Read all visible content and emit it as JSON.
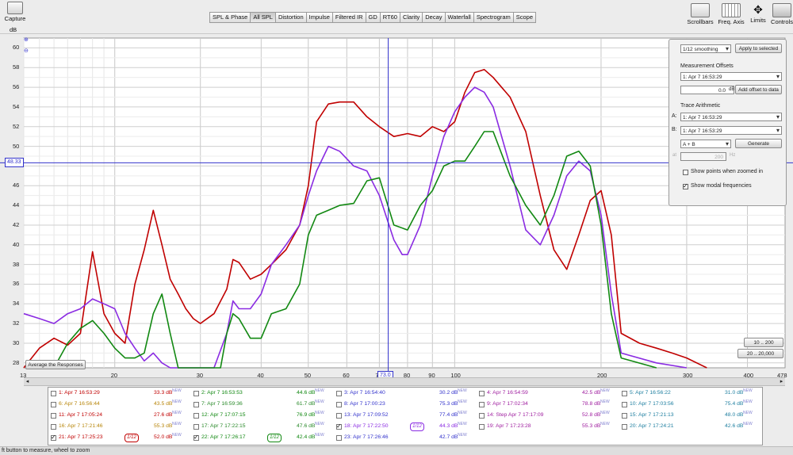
{
  "toolbar": {
    "capture": {
      "label": "Capture"
    },
    "db_label": "dB",
    "tabs": [
      "SPL & Phase",
      "All SPL",
      "Distortion",
      "Impulse",
      "Filtered IR",
      "GD",
      "RT60",
      "Clarity",
      "Decay",
      "Waterfall",
      "Spectrogram",
      "Scope"
    ],
    "active_tab": "All SPL",
    "right": [
      "Scrollbars",
      "Freq. Axis",
      "Limits",
      "Controls"
    ]
  },
  "plot": {
    "y_ticks": [
      "60",
      "58",
      "56",
      "54",
      "52",
      "50",
      "48",
      "46",
      "44",
      "42",
      "40",
      "38",
      "36",
      "34",
      "32",
      "30",
      "28"
    ],
    "x_ticks": [
      "13",
      "20",
      "30",
      "40",
      "50",
      "60",
      "70",
      "80",
      "90",
      "100",
      "200",
      "300",
      "400",
      "478 Hz"
    ],
    "cursor_y_label": "48.33",
    "cursor_x_label": "73.0",
    "average_button": "Average the Responses",
    "range_buttons": [
      "10 .. 200",
      "20 .. 20,000"
    ]
  },
  "chart_data": {
    "type": "line",
    "xlim": [
      13,
      478
    ],
    "ylim": [
      27.5,
      61
    ],
    "xscale": "log",
    "grid": true,
    "series": [
      {
        "color": "#c00000",
        "x": [
          13,
          14,
          15,
          16,
          17,
          18,
          19,
          20,
          21,
          22,
          23,
          24,
          25,
          26,
          27,
          28,
          29,
          30,
          32,
          34,
          35,
          36,
          38,
          40,
          42,
          45,
          48,
          50,
          52,
          55,
          58,
          62,
          66,
          70,
          75,
          80,
          85,
          90,
          95,
          100,
          105,
          110,
          115,
          120,
          130,
          140,
          150,
          160,
          170,
          180,
          190,
          200,
          210,
          220,
          240,
          260,
          280,
          300,
          330
        ],
        "y": [
          27.5,
          29.5,
          30.5,
          29.8,
          31,
          39.3,
          33,
          31,
          30,
          36,
          39.5,
          43.5,
          40,
          36.5,
          35,
          33.5,
          32.5,
          32,
          33,
          35.5,
          38.5,
          38.2,
          36.5,
          37,
          38,
          39.5,
          42,
          46,
          52.5,
          54.3,
          54.5,
          54.5,
          53,
          52,
          51,
          51.3,
          51,
          52,
          51.5,
          52.5,
          55.5,
          57.5,
          57.8,
          57,
          55,
          51.5,
          45,
          39.5,
          37.5,
          41,
          44.5,
          45.5,
          41,
          31,
          30,
          29.5,
          29,
          28.5,
          27.5
        ]
      },
      {
        "color": "#8a2be2",
        "x": [
          13,
          14,
          15,
          16,
          17,
          18,
          19,
          20,
          21,
          22,
          23,
          24,
          25,
          26,
          27,
          30,
          32,
          34,
          35,
          36,
          38,
          40,
          42,
          45,
          48,
          50,
          52,
          55,
          58,
          62,
          66,
          70,
          75,
          78,
          80,
          85,
          90,
          95,
          100,
          105,
          110,
          115,
          120,
          130,
          140,
          150,
          160,
          170,
          180,
          190,
          200,
          210,
          220,
          260,
          300
        ],
        "y": [
          33,
          32.5,
          32,
          33,
          33.5,
          34.5,
          34,
          33.5,
          31,
          29.5,
          28.2,
          29,
          28,
          27.5,
          27.5,
          27.5,
          27.5,
          31,
          34.3,
          33.5,
          33.5,
          35,
          38,
          40,
          42,
          45,
          47.5,
          50,
          49.5,
          48,
          47.5,
          45,
          40.5,
          39,
          39,
          42,
          47,
          51,
          53.5,
          55,
          56,
          55.5,
          54,
          48,
          41.5,
          40,
          43,
          47,
          48.5,
          47.5,
          43,
          35,
          29,
          28,
          27.5
        ]
      },
      {
        "color": "#118811",
        "x": [
          15,
          16,
          17,
          18,
          19,
          20,
          21,
          22,
          23,
          24,
          25,
          26,
          27,
          30,
          33,
          34,
          35,
          36,
          38,
          40,
          42,
          45,
          48,
          50,
          52,
          55,
          58,
          62,
          66,
          70,
          75,
          80,
          85,
          90,
          95,
          100,
          105,
          110,
          115,
          120,
          130,
          140,
          150,
          160,
          170,
          180,
          190,
          200,
          210,
          220,
          260
        ],
        "y": [
          27.5,
          30,
          31.5,
          32.3,
          31,
          29.5,
          28.5,
          28.5,
          29,
          33,
          35,
          31,
          27.5,
          27.5,
          27.5,
          31,
          33,
          32.5,
          30.5,
          30.5,
          33,
          33.5,
          36,
          41,
          43,
          43.5,
          44,
          44.2,
          46.5,
          46.8,
          42,
          41.5,
          44,
          45.5,
          48,
          48.5,
          48.5,
          50,
          51.5,
          51.5,
          47,
          44,
          42,
          45,
          49,
          49.5,
          48,
          42,
          33,
          28.5,
          27.5
        ]
      }
    ]
  },
  "panel": {
    "smoothing": "1/12 smoothing",
    "apply_btn": "Apply to selected",
    "offsets_title": "Measurement Offsets",
    "offset_meas": "1: Apr 7 16:53:29",
    "offset_value": "0.0",
    "offset_unit": "dB",
    "add_offset_btn": "Add offset to data",
    "arith_title": "Trace Arithmetic",
    "a_label": "A:",
    "a_value": "1: Apr 7 16:53:29",
    "b_label": "B:",
    "b_value": "1: Apr 7 16:53:29",
    "op_value": "A + B",
    "generate_btn": "Generate",
    "at_label": "at",
    "at_value": "200",
    "at_unit": "Hz",
    "show_points": "Show points when zoomed in",
    "show_modal": "Show modal frequencies"
  },
  "legend": [
    [
      {
        "n": "1: Apr 7 16:53:29",
        "d": "33.3 dB",
        "c": "#c00000",
        "on": false
      },
      {
        "n": "2: Apr 7 16:53:53",
        "d": "44.6 dB",
        "c": "#118811",
        "on": false
      },
      {
        "n": "3: Apr 7 16:54:40",
        "d": "30.2 dB",
        "c": "#3333cc",
        "on": false
      },
      {
        "n": "4: Apr 7 16:54:59",
        "d": "42.5 dB",
        "c": "#a020a0",
        "on": false
      },
      {
        "n": "5: Apr 7 16:56:22",
        "d": "31.0 dB",
        "c": "#1f7fa0",
        "on": false
      }
    ],
    [
      {
        "n": "6: Apr 7 16:56:44",
        "d": "43.5 dB",
        "c": "#b8860b",
        "on": false
      },
      {
        "n": "7: Apr 7 16:59:36",
        "d": "61.7 dB",
        "c": "#2a8a2a",
        "on": false
      },
      {
        "n": "8: Apr 7 17:00:23",
        "d": "75.3 dB",
        "c": "#3333cc",
        "on": false
      },
      {
        "n": "9: Apr 7 17:02:34",
        "d": "78.8 dB",
        "c": "#a020a0",
        "on": false
      },
      {
        "n": "10: Apr 7 17:03:56",
        "d": "75.4 dB",
        "c": "#1f7fa0",
        "on": false
      }
    ],
    [
      {
        "n": "11: Apr 7 17:05:24",
        "d": "27.6 dB",
        "c": "#c00000",
        "on": false
      },
      {
        "n": "12: Apr 7 17:07:15",
        "d": "76.9 dB",
        "c": "#118811",
        "on": false
      },
      {
        "n": "13: Apr 7 17:09:52",
        "d": "77.4 dB",
        "c": "#3333cc",
        "on": false
      },
      {
        "n": "14: Step Apr 7 17:17:09",
        "d": "52.8 dB",
        "c": "#a020a0",
        "on": false
      },
      {
        "n": "15: Apr 7 17:21:13",
        "d": "48.0 dB",
        "c": "#1f7fa0",
        "on": false
      }
    ],
    [
      {
        "n": "16: Apr 7 17:21:46",
        "d": "55.3 dB",
        "c": "#b8860b",
        "on": false
      },
      {
        "n": "17: Apr 7 17:22:15",
        "d": "47.6 dB",
        "c": "#2a8a2a",
        "on": false
      },
      {
        "n": "18: Apr 7 17:22:50",
        "d": "44.3 dB",
        "c": "#8a2be2",
        "on": true,
        "sm": "1/12"
      },
      {
        "n": "19: Apr 7 17:23:28",
        "d": "55.3 dB",
        "c": "#a020a0",
        "on": false
      },
      {
        "n": "20: Apr 7 17:24:21",
        "d": "42.6 dB",
        "c": "#1f7fa0",
        "on": false
      }
    ],
    [
      {
        "n": "21: Apr 7 17:25:23",
        "d": "52.0 dB",
        "c": "#c00000",
        "on": true,
        "sm": "1/12"
      },
      {
        "n": "22: Apr 7 17:26:17",
        "d": "42.4 dB",
        "c": "#118811",
        "on": true,
        "sm": "1/12"
      },
      {
        "n": "23: Apr 7 17:26:46",
        "d": "42.7 dB",
        "c": "#3333cc",
        "on": false
      }
    ]
  ],
  "legend_new": "NEW",
  "status": "ft button to measure, wheel to zoom"
}
